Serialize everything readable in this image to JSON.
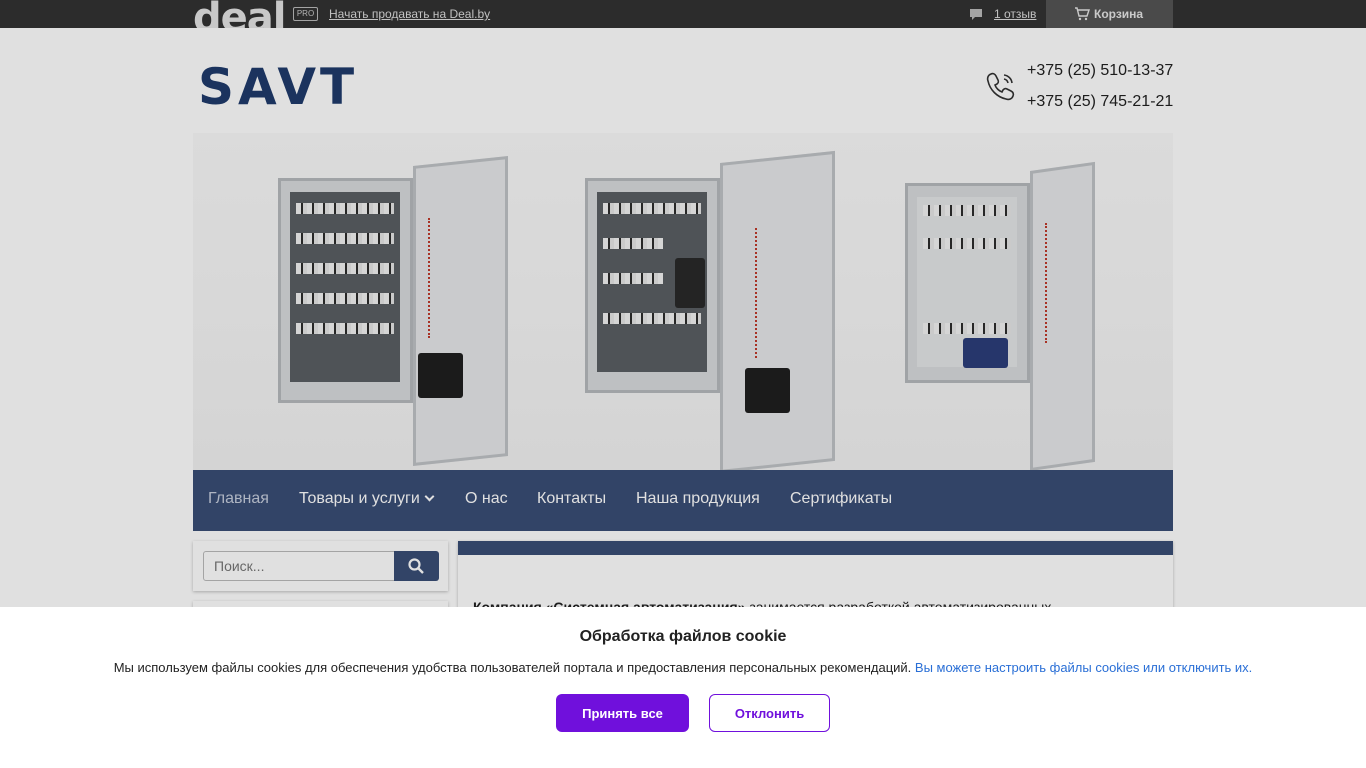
{
  "topbar": {
    "logo_text": "deal",
    "pro_badge": "PRO",
    "sell_link": "Начать продавать на Deal.by",
    "reviews_link": "1 отзыв",
    "cart_label": "Корзина"
  },
  "header": {
    "logo_text": "SAVT",
    "phones": [
      "+375 (25) 510-13-37",
      "+375 (25) 745-21-21"
    ]
  },
  "nav": {
    "items": [
      {
        "label": "Главная",
        "active": true
      },
      {
        "label": "Товары и услуги",
        "has_dropdown": true
      },
      {
        "label": "О нас"
      },
      {
        "label": "Контакты"
      },
      {
        "label": "Наша продукция"
      },
      {
        "label": "Сертификаты"
      }
    ]
  },
  "sidebar": {
    "search_placeholder": "Поиск..."
  },
  "content": {
    "intro_bold": "Компания «Системная автоматизация»",
    "intro_rest": " занимается  разработкой автоматизированных"
  },
  "cookie": {
    "title": "Обработка файлов cookie",
    "text": "Мы используем файлы cookies для обеспечения удобства пользователей портала и предоставления персональных рекомендаций.",
    "link": "Вы можете настроить файлы cookies или отключить их.",
    "accept": "Принять все",
    "decline": "Отклонить"
  },
  "colors": {
    "brand_blue": "#3a4e76",
    "cookie_purple": "#7010dc",
    "topbar": "#333333"
  }
}
